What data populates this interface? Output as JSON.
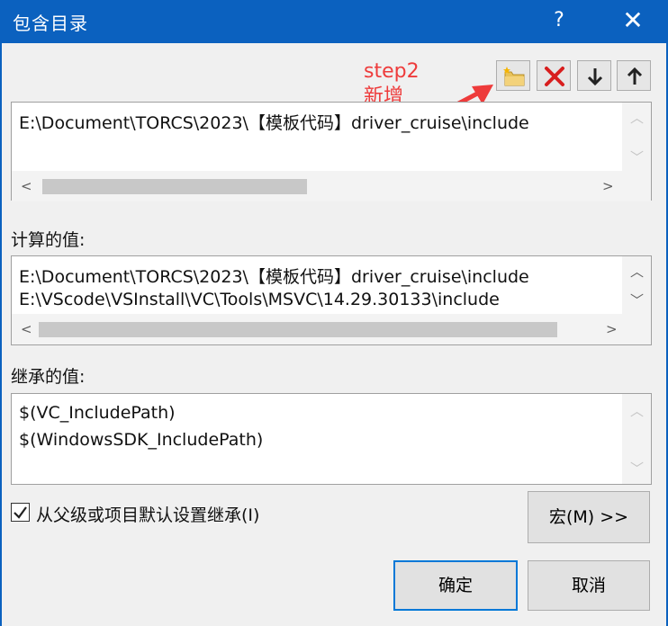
{
  "dialog": {
    "title": "包含目录",
    "help_label": "?",
    "close_label": "✕"
  },
  "toolbar": {
    "new_line_tooltip": "新行",
    "delete_tooltip": "删除",
    "move_down_tooltip": "下移",
    "move_up_tooltip": "上移"
  },
  "annotation": {
    "step": "step2",
    "note": "新增",
    "color": "#ee3b3b"
  },
  "edit_box": {
    "lines": [
      "E:\\Document\\TORCS\\2023\\【模板代码】driver_cruise\\include"
    ]
  },
  "evaluated": {
    "label": "计算的值:",
    "lines": [
      "E:\\Document\\TORCS\\2023\\【模板代码】driver_cruise\\include",
      "E:\\VScode\\VSInstall\\VC\\Tools\\MSVC\\14.29.30133\\include"
    ]
  },
  "inherited": {
    "label": "继承的值:",
    "lines": [
      "$(VC_IncludePath)",
      "$(WindowsSDK_IncludePath)"
    ]
  },
  "inherit_checkbox": {
    "label": "从父级或项目默认设置继承(I)",
    "checked": true
  },
  "buttons": {
    "macros": "宏(M) >>",
    "ok": "确定",
    "cancel": "取消"
  },
  "colors": {
    "titlebar": "#0b61bf",
    "window_bg": "#f0f0f0",
    "default_button_border": "#0078d7"
  }
}
